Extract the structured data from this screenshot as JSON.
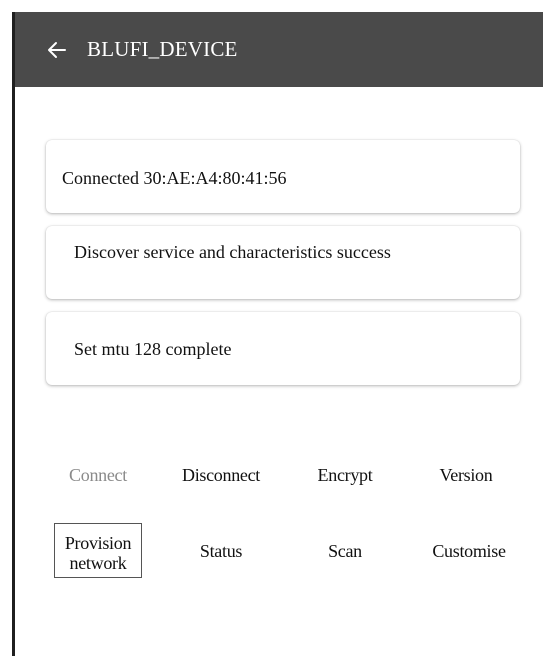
{
  "app_bar": {
    "title": "BLUFI_DEVICE",
    "back_icon": "arrow-left-icon",
    "background": "#4a4a4a"
  },
  "messages": [
    {
      "text": "Connected 30:AE:A4:80:41:56"
    },
    {
      "text": "Discover service and characteristics success"
    },
    {
      "text": "Set mtu 128 complete"
    }
  ],
  "actions": {
    "connect": {
      "label": "Connect",
      "enabled": false
    },
    "disconnect": {
      "label": "Disconnect"
    },
    "encrypt": {
      "label": "Encrypt"
    },
    "version": {
      "label": "Version"
    },
    "provision": {
      "label": "Provision network"
    },
    "status": {
      "label": "Status"
    },
    "scan": {
      "label": "Scan"
    },
    "customise": {
      "label": "Customise"
    }
  }
}
